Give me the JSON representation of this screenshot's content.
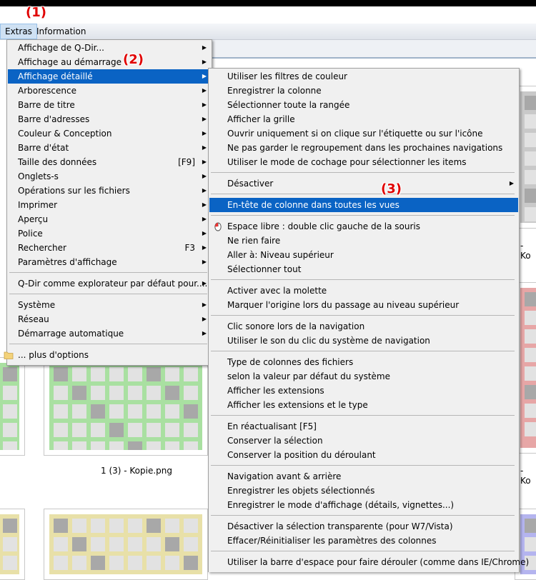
{
  "annotations": {
    "m1": "(1)",
    "m2": "(2)",
    "m3": "(3)"
  },
  "menubar": {
    "extras": "Extras",
    "information": "Information"
  },
  "captions": {
    "thumb_middle": "1 (3) - Kopie.png",
    "right_a": "- Ko",
    "right_b": "- Ko"
  },
  "colors": {
    "green": "#a9e0a1",
    "red": "#e7a6a6",
    "yellow": "#e8e0a8",
    "gray": "#c9c9c9",
    "blue_purple": "#b4b4ef",
    "selection": "#0a63c4"
  },
  "main_menu": {
    "items": [
      {
        "label": "Affichage de Q-Dir...",
        "arrow": "▶"
      },
      {
        "label": "Affichage au démarrage",
        "arrow": "▶"
      },
      {
        "label": "Affichage détaillé",
        "arrow": "▶",
        "selected": true
      },
      {
        "label": "Arborescence",
        "arrow": "▶"
      },
      {
        "label": "Barre de titre",
        "arrow": "▶"
      },
      {
        "label": "Barre d'adresses",
        "arrow": "▶"
      },
      {
        "label": "Couleur & Conception",
        "arrow": "▶"
      },
      {
        "label": "Barre d'état",
        "arrow": "▶"
      },
      {
        "label": "Taille des données",
        "shortcut": "[F9]",
        "arrow": "▶"
      },
      {
        "label": "Onglets-s",
        "arrow": "▶"
      },
      {
        "label": "Opérations sur les fichiers",
        "arrow": "▶"
      },
      {
        "label": "Imprimer",
        "arrow": "▶"
      },
      {
        "label": "Aperçu",
        "arrow": "▶"
      },
      {
        "label": "Police",
        "arrow": "▶"
      },
      {
        "label": "Rechercher",
        "shortcut": "F3",
        "arrow": "▶"
      },
      {
        "label": "Paramètres d'affichage",
        "arrow": "▶"
      },
      {
        "separator": true
      },
      {
        "label": "Q-Dir comme explorateur par défaut pour....",
        "arrow": "▶"
      },
      {
        "separator": true
      },
      {
        "label": "Système",
        "arrow": "▶"
      },
      {
        "label": "Réseau",
        "arrow": "▶"
      },
      {
        "label": "Démarrage automatique",
        "arrow": "▶"
      },
      {
        "separator": true
      },
      {
        "label": "... plus d'options",
        "icon": "folder-icon"
      }
    ]
  },
  "sub_menu": {
    "items": [
      {
        "label": "Utiliser les filtres de couleur"
      },
      {
        "label": "Enregistrer la colonne"
      },
      {
        "label": "Sélectionner toute la rangée"
      },
      {
        "label": "Afficher la grille"
      },
      {
        "label": "Ouvrir uniquement si on clique sur l'étiquette ou sur l'icône"
      },
      {
        "label": "Ne pas garder le regroupement dans les prochaines navigations"
      },
      {
        "label": "Utiliser le mode de cochage pour sélectionner les items"
      },
      {
        "separator": true
      },
      {
        "label": "Désactiver",
        "arrow": "▶"
      },
      {
        "separator": true
      },
      {
        "label": "En-tête de colonne dans toutes les vues",
        "selected": true
      },
      {
        "separator": true
      },
      {
        "label": "Espace libre : double clic gauche de la souris",
        "icon": "mouse-icon"
      },
      {
        "label": "Ne rien faire"
      },
      {
        "label": "Aller à: Niveau supérieur"
      },
      {
        "label": "Sélectionner tout"
      },
      {
        "separator": true
      },
      {
        "label": "Activer avec la molette"
      },
      {
        "label": "Marquer l'origine lors du passage au niveau supérieur"
      },
      {
        "separator": true
      },
      {
        "label": "Clic sonore lors de la navigation"
      },
      {
        "label": "Utiliser le son du clic du système de navigation"
      },
      {
        "separator": true
      },
      {
        "label": "Type de colonnes des fichiers"
      },
      {
        "label": "selon la valeur par défaut du système"
      },
      {
        "label": "Afficher les extensions"
      },
      {
        "label": "Afficher les extensions et le type"
      },
      {
        "separator": true
      },
      {
        "label": "En réactualisant [F5]"
      },
      {
        "label": "Conserver la sélection"
      },
      {
        "label": "Conserver la position du déroulant"
      },
      {
        "separator": true
      },
      {
        "label": "Navigation avant & arrière"
      },
      {
        "label": "Enregistrer les objets sélectionnés"
      },
      {
        "label": "Enregistrer le mode d'affichage (détails, vignettes...)"
      },
      {
        "separator": true
      },
      {
        "label": "Désactiver la sélection transparente (pour W7/Vista)"
      },
      {
        "label": "Effacer/Réinitialiser les paramètres des colonnes"
      },
      {
        "separator": true
      },
      {
        "label": "Utiliser la barre d'espace pour faire dérouler (comme dans IE/Chrome)"
      }
    ]
  }
}
